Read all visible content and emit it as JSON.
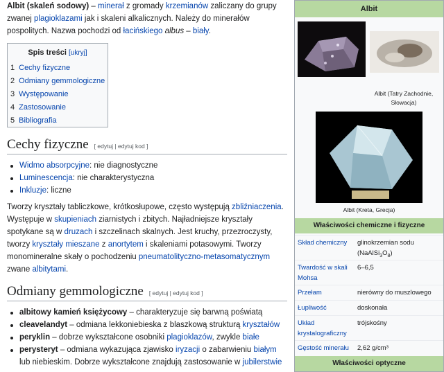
{
  "intro": {
    "bold": "Albit (skaleń sodowy)",
    "t1": " – ",
    "link_mineral": "minerał",
    "t2": " z gromady ",
    "link_krzemiany": "krzemianów",
    "t3": " zaliczany do grupy zwanej ",
    "link_plagioklazy": "plagioklazami",
    "t4": " jak i skaleni alkalicznych. Należy do minerałów pospolitych. Nazwa pochodzi od ",
    "link_lacinski": "łacińskiego",
    "t5": " ",
    "italic": "albus",
    "t6": " – ",
    "link_bialy": "biały",
    "t7": "."
  },
  "toc": {
    "title": "Spis treści",
    "hide": "[ukryj]",
    "items": [
      {
        "num": "1",
        "label": "Cechy fizyczne"
      },
      {
        "num": "2",
        "label": "Odmiany gemmologiczne"
      },
      {
        "num": "3",
        "label": "Występowanie"
      },
      {
        "num": "4",
        "label": "Zastosowanie"
      },
      {
        "num": "5",
        "label": "Bibliografia"
      }
    ]
  },
  "section1": {
    "title": "Cechy fizyczne",
    "edit": "[ edytuj | edytuj kod ]",
    "bullets": [
      {
        "link": "Widmo absorpcyjne",
        "text": ": nie diagnostyczne"
      },
      {
        "link": "Luminescencja",
        "text": ": nie charakterystyczna"
      },
      {
        "link": "Inkluzje",
        "text": ": liczne"
      }
    ],
    "para": {
      "a": "Tworzy kryształy tabliczkowe, krótkosłupowe, często występują ",
      "l1": "zbliźniaczenia",
      "b": ". Występuje w ",
      "l2": "skupieniach",
      "c": " ziarnistych i zbitych. Najładniejsze kryształy spotykane są w ",
      "l3": "druzach",
      "d": " i szczelinach skalnych. Jest kruchy, przezroczysty, tworzy ",
      "l4": "kryształy mieszane",
      "e": " z ",
      "l5": "anortytem",
      "f": " i skaleniami potasowymi. Tworzy monomineralne skały o pochodzeniu ",
      "l6": "pneumatolityczno-metasomatycznym",
      "g": " zwane ",
      "l7": "albitytami",
      "h": "."
    }
  },
  "section2": {
    "title": "Odmiany gemmologiczne",
    "edit": "[ edytuj | edytuj kod ]",
    "bullets": [
      {
        "bold": "albitowy kamień księżycowy",
        "a": " – charakteryzuje się barwną poświatą",
        "link": "",
        "b": ""
      },
      {
        "bold": "cleavelandyt",
        "a": " – odmiana lekkoniebieska z blaszkową strukturą ",
        "link": "kryształów",
        "b": ""
      },
      {
        "bold": "peryklin",
        "a": " – dobrze wykształcone osobniki ",
        "link": "plagioklazów",
        "b": ", zwykle ",
        "link2": "białe"
      },
      {
        "bold": "perysteryt",
        "a": " – odmiana wykazująca zjawisko ",
        "link": "iryzacji",
        "b": " o zabarwieniu ",
        "link2": "białym",
        "c": " lub niebieskim. Dobrze wykształcone znajdują zastosowanie w ",
        "link3": "jubilerstwie"
      }
    ]
  },
  "infobox": {
    "title": "Albit",
    "caption1": "Albit (Tatry Zachodnie, Słowacja)",
    "caption2": "Albit (Kreta, Grecja)",
    "section_chem": "Właściwości chemiczne i fizyczne",
    "rows": [
      {
        "key": "Skład chemiczny",
        "value": "glinokrzemian sodu (NaAlSi",
        "sub1": "3",
        "value2": "O",
        "sub2": "8",
        "value3": ")"
      },
      {
        "key": "Twardość w skali Mohsa",
        "value": "6–6,5"
      },
      {
        "key": "Przełam",
        "value": "nierówny do muszlowego"
      },
      {
        "key": "Łupliwość",
        "value": "doskonała"
      },
      {
        "key": "Układ krystalograficzny",
        "value": "trójskośny"
      },
      {
        "key": "Gęstość minerału",
        "value": "2,62 g/cm³"
      }
    ],
    "section_opt": "Właściwości optyczne"
  }
}
